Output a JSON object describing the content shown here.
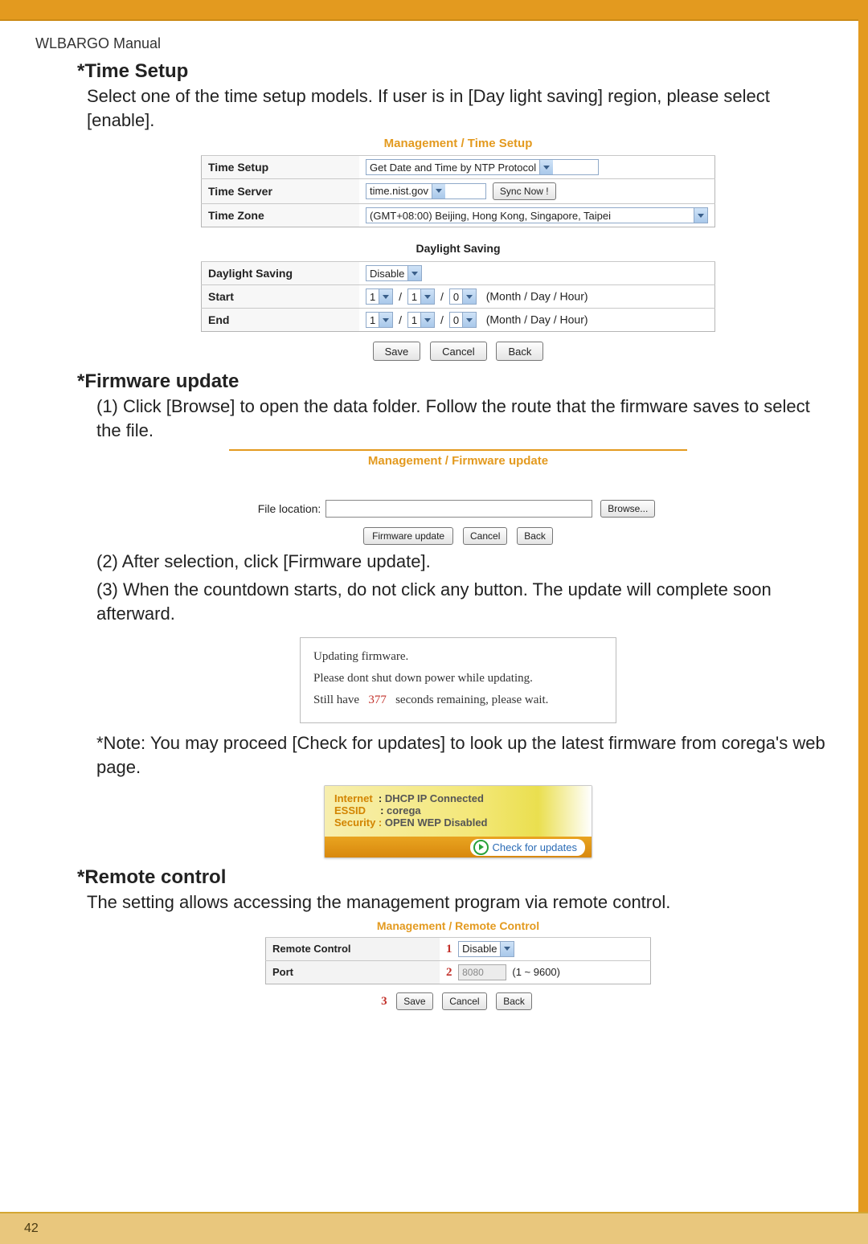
{
  "manual_header": "WLBARGO Manual",
  "page_number": "42",
  "time_setup": {
    "heading": "*Time Setup",
    "desc": "Select one of the time setup models. If user is in [Day light saving] region, please select [enable].",
    "fig_title": "Management / Time Setup",
    "rows": {
      "time_setup_label": "Time Setup",
      "time_setup_value": "Get Date and Time by NTP Protocol",
      "time_server_label": "Time Server",
      "time_server_value": "time.nist.gov",
      "sync_btn": "Sync Now !",
      "time_zone_label": "Time Zone",
      "time_zone_value": "(GMT+08:00) Beijing, Hong Kong, Singapore, Taipei"
    },
    "daylight": {
      "title": "Daylight Saving",
      "ds_label": "Daylight Saving",
      "ds_value": "Disable",
      "start_label": "Start",
      "end_label": "End",
      "m": "1",
      "d": "1",
      "h": "0",
      "hint": "(Month / Day / Hour)"
    },
    "buttons": {
      "save": "Save",
      "cancel": "Cancel",
      "back": "Back"
    }
  },
  "firmware": {
    "heading": "*Firmware update",
    "step1": "(1) Click [Browse] to open the data folder.  Follow the route that the firmware saves to select the file.",
    "fig_title": "Management / Firmware update",
    "file_label": "File location:",
    "browse_btn": "Browse...",
    "btn_update": "Firmware update",
    "btn_cancel": "Cancel",
    "btn_back": "Back",
    "step2": "(2) After selection, click [Firmware update].",
    "step3": "(3) When the countdown starts, do not click any button.  The update will complete soon afterward.",
    "updating": {
      "l1": "Updating firmware.",
      "l2": "Please dont shut down power while updating.",
      "l3a": "Still have",
      "seconds": "377",
      "l3b": "seconds remaining, please wait."
    },
    "note": "*Note: You may proceed [Check for updates] to look up the latest firmware from corega's web page.",
    "status": {
      "internet_lbl": "Internet",
      "internet_val": "DHCP IP Connected",
      "essid_lbl": "ESSID",
      "essid_val": "corega",
      "security_lbl": "Security :",
      "security_val": "OPEN  WEP Disabled",
      "check": "Check for updates"
    }
  },
  "remote": {
    "heading": "*Remote control",
    "desc": "The setting allows accessing the management program via remote control.",
    "fig_title": "Management / Remote Control",
    "rc_label": "Remote Control",
    "rc_value": "Disable",
    "port_label": "Port",
    "port_value": "8080",
    "port_range": "(1 ~ 9600)",
    "n1": "1",
    "n2": "2",
    "n3": "3",
    "save": "Save",
    "cancel": "Cancel",
    "back": "Back"
  }
}
